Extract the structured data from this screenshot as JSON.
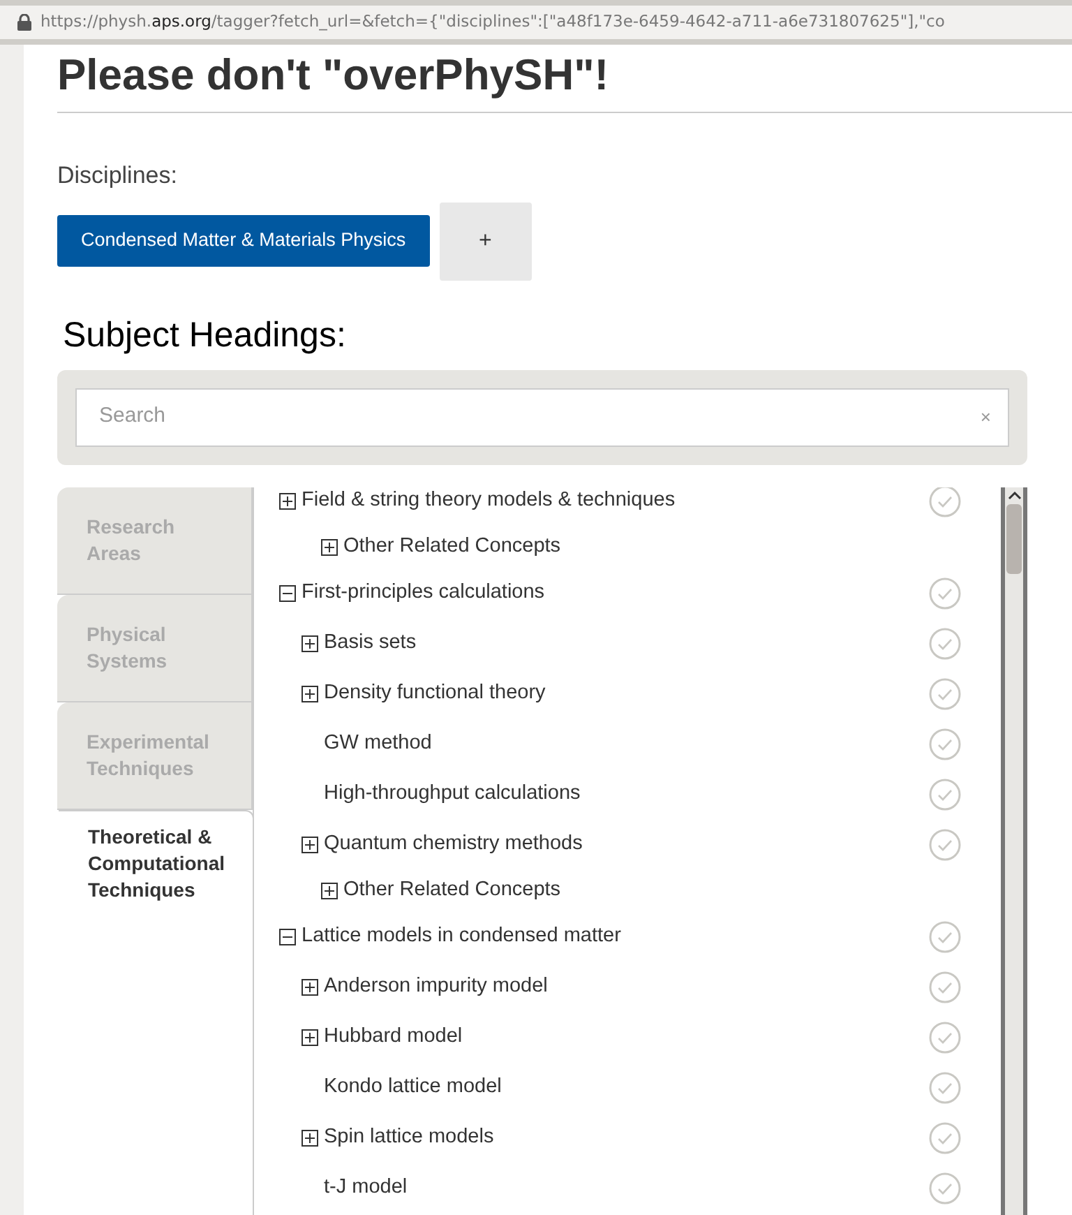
{
  "address_bar": {
    "url_prefix": "https://physh.",
    "url_domain": "aps.org",
    "url_rest": "/tagger?fetch_url=&fetch={\"disciplines\":[\"a48f173e-6459-4642-a711-a6e731807625\"],\"co"
  },
  "title": "Please don't \"overPhySH\"!",
  "disciplines": {
    "label": "Disciplines:",
    "items": [
      {
        "label": "Condensed Matter & Materials Physics",
        "selected": true
      }
    ],
    "add_button": "+"
  },
  "subject_headings": {
    "label": "Subject Headings:",
    "search": {
      "placeholder": "Search",
      "clear": "×"
    },
    "tabs": [
      {
        "label": "Research Areas",
        "selected": false
      },
      {
        "label": "Physical Systems",
        "selected": false
      },
      {
        "label": "Experimental Techniques",
        "selected": false
      },
      {
        "label": "Theoretical & Computational Techniques",
        "selected": true
      }
    ],
    "tree": [
      {
        "label": "Field & string theory models & techniques",
        "kind": "heading",
        "expanded": false,
        "checked": false
      },
      {
        "label": "Other Related Concepts",
        "kind": "related",
        "expanded": false
      },
      {
        "label": "First-principles calculations",
        "kind": "heading",
        "expanded": true,
        "checked": false,
        "children": [
          {
            "label": "Basis sets",
            "kind": "heading",
            "expanded": false,
            "checked": false
          },
          {
            "label": "Density functional theory",
            "kind": "heading",
            "expanded": false,
            "checked": false
          },
          {
            "label": "GW method",
            "kind": "heading",
            "checked": false
          },
          {
            "label": "High-throughput calculations",
            "kind": "heading",
            "checked": false
          },
          {
            "label": "Quantum chemistry methods",
            "kind": "heading",
            "expanded": false,
            "checked": false
          },
          {
            "label": "Other Related Concepts",
            "kind": "related",
            "expanded": false
          }
        ]
      },
      {
        "label": "Lattice models in condensed matter",
        "kind": "heading",
        "expanded": true,
        "checked": false,
        "children": [
          {
            "label": "Anderson impurity model",
            "kind": "heading",
            "expanded": false,
            "checked": false
          },
          {
            "label": "Hubbard model",
            "kind": "heading",
            "expanded": false,
            "checked": false
          },
          {
            "label": "Kondo lattice model",
            "kind": "heading",
            "checked": false
          },
          {
            "label": "Spin lattice models",
            "kind": "heading",
            "expanded": false,
            "checked": false
          },
          {
            "label": "t-J model",
            "kind": "heading",
            "checked": false
          }
        ]
      }
    ]
  }
}
